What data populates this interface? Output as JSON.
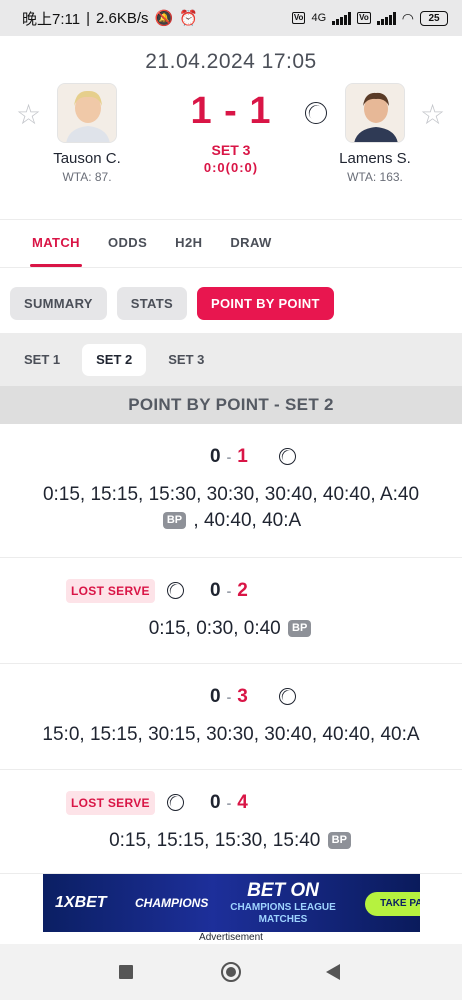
{
  "status_bar": {
    "time": "晚上7:11",
    "speed": "2.6KB/s",
    "network_4g": "4G",
    "volte": "Vo",
    "battery": "25"
  },
  "match": {
    "datetime": "21.04.2024 17:05",
    "score": "1 - 1",
    "set_label": "SET 3",
    "game_score": "0:0(0:0)",
    "home": {
      "name": "Tauson C.",
      "rank": "WTA: 87."
    },
    "away": {
      "name": "Lamens S.",
      "rank": "WTA: 163."
    }
  },
  "main_tabs": [
    "MATCH",
    "ODDS",
    "H2H",
    "DRAW"
  ],
  "sub_tabs": [
    "SUMMARY",
    "STATS",
    "POINT BY POINT"
  ],
  "set_tabs": [
    "SET 1",
    "SET 2",
    "SET 3"
  ],
  "section_title": "POINT BY POINT - SET 2",
  "badges": {
    "lost_serve": "LOST SERVE",
    "break_point": "BP"
  },
  "games": [
    {
      "home": "0",
      "sep": "-",
      "away": "1",
      "points_line1": "0:15, 15:15, 15:30, 30:30, 30:40, 40:40, A:40",
      "points_line2": ", 40:40, 40:A"
    },
    {
      "home": "0",
      "sep": "-",
      "away": "2",
      "points": "0:15, 0:30, 0:40"
    },
    {
      "home": "0",
      "sep": "-",
      "away": "3",
      "points": "15:0, 15:15, 30:15, 30:30, 30:40, 40:40, 40:A"
    },
    {
      "home": "0",
      "sep": "-",
      "away": "4",
      "points": "0:15, 15:15, 15:30, 15:40"
    }
  ],
  "ad": {
    "brand": "1XBET",
    "champions": "CHAMPIONS",
    "headline": "BET ON",
    "subline": "CHAMPIONS LEAGUE MATCHES",
    "cta": "TAKE PART",
    "label": "Advertisement"
  }
}
